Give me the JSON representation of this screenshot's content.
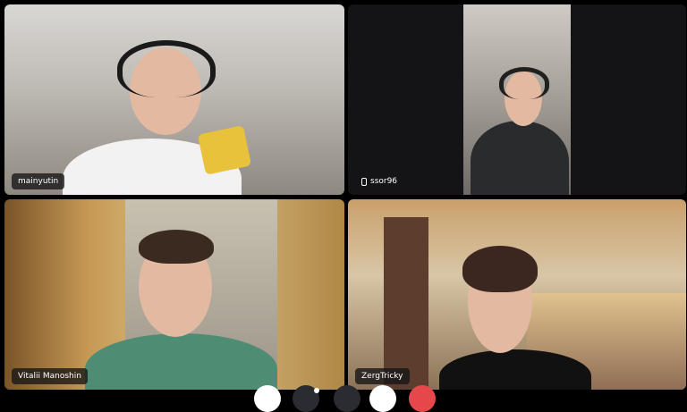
{
  "participants": [
    {
      "name": "mainyutin"
    },
    {
      "name": "ssor96",
      "icon": "phone-icon"
    },
    {
      "name": "Vitalii Manoshin"
    },
    {
      "name": "ZergTricky"
    }
  ],
  "colors": {
    "background": "#000000",
    "label_bg": "#141416",
    "leave_button": "#e5474b"
  },
  "controls": [
    {
      "icon": "camera-icon"
    },
    {
      "icon": "microphone-icon"
    },
    {
      "icon": "screen-share-icon"
    },
    {
      "icon": "more-icon"
    },
    {
      "icon": "leave-call-icon"
    }
  ]
}
